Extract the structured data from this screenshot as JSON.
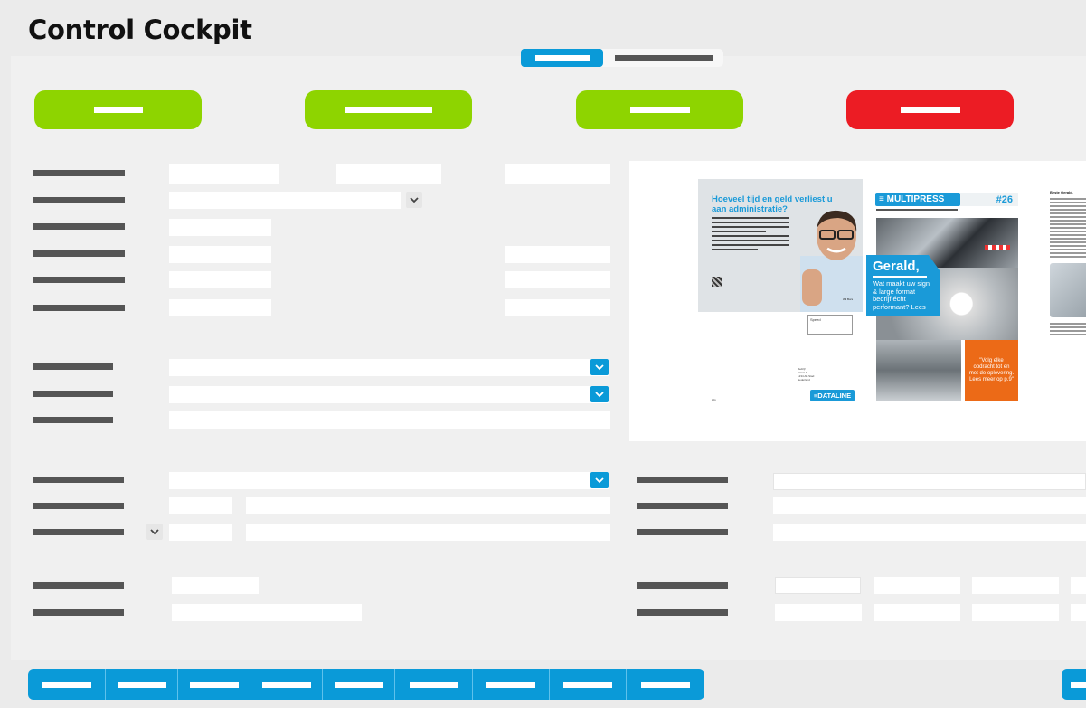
{
  "app": {
    "title": "Control Cockpit"
  },
  "tabs": [
    {
      "label": "",
      "active": true
    },
    {
      "label": "",
      "active": false
    }
  ],
  "actions": [
    {
      "label": "",
      "color": "#8ed400"
    },
    {
      "label": "",
      "color": "#8ed400"
    },
    {
      "label": "",
      "color": "#8ed400"
    },
    {
      "label": "",
      "color": "#ec1c24"
    }
  ],
  "form": {
    "section1": {
      "labels": [
        "",
        "",
        "",
        "",
        "",
        ""
      ],
      "values": [
        "",
        "",
        "",
        "",
        "",
        "",
        "",
        "",
        "",
        "",
        "",
        ""
      ]
    },
    "section2": {
      "labels": [
        "",
        "",
        ""
      ],
      "values": [
        "",
        "",
        ""
      ]
    },
    "section3": {
      "labels": [
        "",
        "",
        "",
        "",
        ""
      ],
      "values": [
        "",
        "",
        "",
        "",
        "",
        "",
        "",
        ""
      ]
    },
    "section4": {
      "labels": [
        "",
        "",
        "",
        "",
        ""
      ],
      "values": [
        "",
        "",
        "",
        "",
        "",
        "",
        "",
        "",
        "",
        "",
        "",
        ""
      ]
    }
  },
  "preview": {
    "ad_headline": "Hoeveel tijd en geld verliest u aan administratie?",
    "ad_caption": "Wil Bors",
    "brand": "≡ MULTIPRESS",
    "issue": "#26",
    "greeting_name": "Gerald,",
    "question": "Wat maakt uw sign & large format bedrijf écht performant? Lees",
    "quote": "\"Volg elke opdracht tot en met de oplevering. Lees meer op p.9\"",
    "footer_brand": "≡DATALINE",
    "letter_greeting": "Beste Gerald,",
    "stamp_text": "Speed",
    "address_lines": [
      "Bedrijf",
      "Straat 1",
      "1234 AB Stad",
      "Nederland"
    ],
    "small_note": "info"
  },
  "toolbar": {
    "buttons": [
      "",
      "",
      "",
      "",
      "",
      "",
      "",
      "",
      ""
    ]
  },
  "colors": {
    "accent": "#0a9ad8",
    "confirm": "#8ed400",
    "danger": "#ec1c24",
    "background": "#f0f0f0"
  }
}
